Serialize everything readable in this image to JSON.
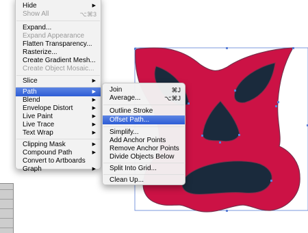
{
  "main_menu": {
    "items": [
      {
        "label": "Hide",
        "submenu": true
      },
      {
        "label": "Show All",
        "shortcut": "⌥⌘3",
        "disabled": true
      },
      {
        "label": "Expand..."
      },
      {
        "label": "Expand Appearance",
        "disabled": true
      },
      {
        "label": "Flatten Transparency..."
      },
      {
        "label": "Rasterize..."
      },
      {
        "label": "Create Gradient Mesh..."
      },
      {
        "label": "Create Object Mosaic...",
        "disabled": true
      },
      {
        "label": "Slice",
        "submenu": true
      },
      {
        "label": "Path",
        "submenu": true,
        "highlighted": true
      },
      {
        "label": "Blend",
        "submenu": true
      },
      {
        "label": "Envelope Distort",
        "submenu": true
      },
      {
        "label": "Live Paint",
        "submenu": true
      },
      {
        "label": "Live Trace",
        "submenu": true
      },
      {
        "label": "Text Wrap",
        "submenu": true
      },
      {
        "label": "Clipping Mask",
        "submenu": true
      },
      {
        "label": "Compound Path",
        "submenu": true
      },
      {
        "label": "Convert to Artboards"
      },
      {
        "label": "Graph",
        "submenu": true
      }
    ]
  },
  "path_submenu": {
    "items": [
      {
        "label": "Join",
        "shortcut": "⌘J"
      },
      {
        "label": "Average...",
        "shortcut": "⌥⌘J"
      },
      {
        "label": "Outline Stroke"
      },
      {
        "label": "Offset Path...",
        "highlighted": true
      },
      {
        "label": "Simplify..."
      },
      {
        "label": "Add Anchor Points"
      },
      {
        "label": "Remove Anchor Points"
      },
      {
        "label": "Divide Objects Below"
      },
      {
        "label": "Split Into Grid..."
      },
      {
        "label": "Clean Up..."
      }
    ]
  },
  "colors": {
    "mask_fill": "#cc1245",
    "mask_outline": "#7a2e4b",
    "eye_fill": "#1a2a3c",
    "selection": "#5b7fd6",
    "highlight": "#3a66db"
  },
  "icons": {
    "submenu_arrow": "▶"
  }
}
